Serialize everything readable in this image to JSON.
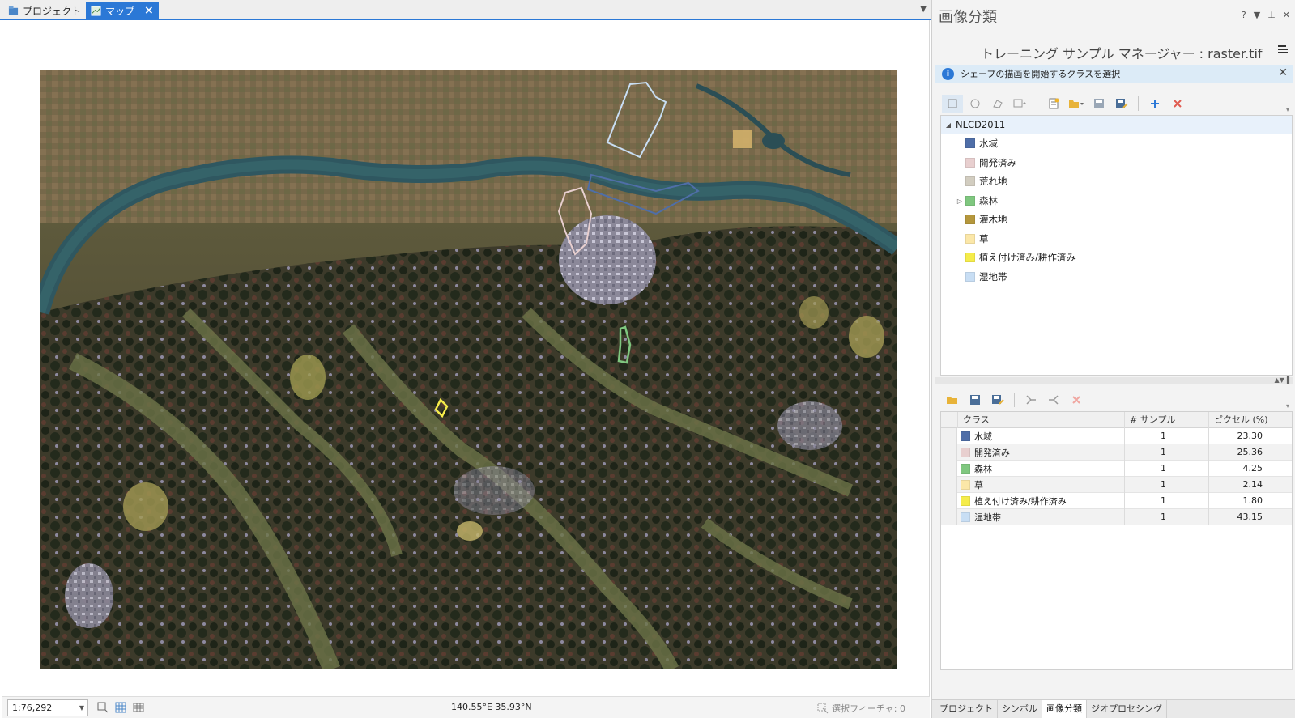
{
  "view_tabs": [
    {
      "label": "プロジェクト",
      "active": false
    },
    {
      "label": "マップ",
      "active": true
    }
  ],
  "map": {
    "scale": "1:76,292",
    "coordinates": "140.55°E 35.93°N",
    "selected_features": "選択フィーチャ: 0"
  },
  "pane": {
    "title": "画像分類",
    "help": "?",
    "manager_title": "トレーニング サンプル マネージャー : raster.tif",
    "info_message": "シェープの描画を開始するクラスを選択"
  },
  "schema": {
    "root": "NLCD2011",
    "classes": [
      {
        "name": "水域",
        "color": "#4f6ea8",
        "expandable": false
      },
      {
        "name": "開発済み",
        "color": "#e8cfcf",
        "expandable": false
      },
      {
        "name": "荒れ地",
        "color": "#d2cdc0",
        "expandable": false
      },
      {
        "name": "森林",
        "color": "#7fc77f",
        "expandable": true
      },
      {
        "name": "灌木地",
        "color": "#b5973c",
        "expandable": false
      },
      {
        "name": "草",
        "color": "#fbe7a8",
        "expandable": false
      },
      {
        "name": "植え付け済み/耕作済み",
        "color": "#f5ec4a",
        "expandable": false
      },
      {
        "name": "湿地帯",
        "color": "#c8def4",
        "expandable": false
      }
    ]
  },
  "samples_table": {
    "headers": [
      "クラス",
      "# サンプル",
      "ピクセル (%)"
    ],
    "rows": [
      {
        "class": "水域",
        "color": "#4f6ea8",
        "samples": "1",
        "pixels": "23.30"
      },
      {
        "class": "開発済み",
        "color": "#e8cfcf",
        "samples": "1",
        "pixels": "25.36"
      },
      {
        "class": "森林",
        "color": "#7fc77f",
        "samples": "1",
        "pixels": "4.25"
      },
      {
        "class": "草",
        "color": "#fbe7a8",
        "samples": "1",
        "pixels": "2.14"
      },
      {
        "class": "植え付け済み/耕作済み",
        "color": "#f5ec4a",
        "samples": "1",
        "pixels": "1.80"
      },
      {
        "class": "湿地帯",
        "color": "#c8def4",
        "samples": "1",
        "pixels": "43.15"
      }
    ]
  },
  "bottom_tabs": [
    {
      "label": "プロジェクト",
      "active": false
    },
    {
      "label": "シンボル",
      "active": false
    },
    {
      "label": "画像分類",
      "active": true
    },
    {
      "label": "ジオプロセシング",
      "active": false
    }
  ],
  "colors": {
    "accent": "#2b78d6",
    "info_bg": "#dcebf7",
    "delete_red": "#e05a4f"
  }
}
